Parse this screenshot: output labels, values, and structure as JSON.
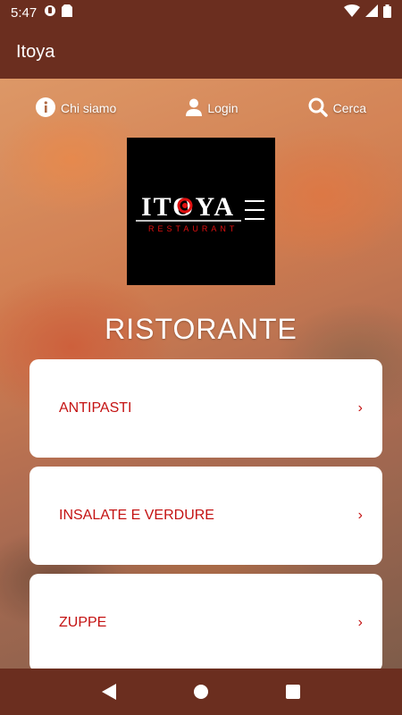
{
  "status": {
    "time": "5:47",
    "icons": [
      "notification-icon",
      "sim-card-icon",
      "wifi-icon",
      "signal-icon",
      "battery-icon"
    ]
  },
  "app": {
    "title": "Itoya"
  },
  "top_menu": {
    "about": "Chi siamo",
    "login": "Login",
    "search": "Cerca"
  },
  "logo": {
    "name": "ITOYA",
    "sub": "RESTAURANT"
  },
  "section": {
    "title": "RISTORANTE"
  },
  "categories": [
    {
      "label": "ANTIPASTI",
      "chevron": "›"
    },
    {
      "label": "INSALATE E VERDURE",
      "chevron": "›"
    },
    {
      "label": "ZUPPE",
      "chevron": "›"
    }
  ],
  "colors": {
    "brand": "#6b2e1f",
    "accent": "#c41212"
  }
}
